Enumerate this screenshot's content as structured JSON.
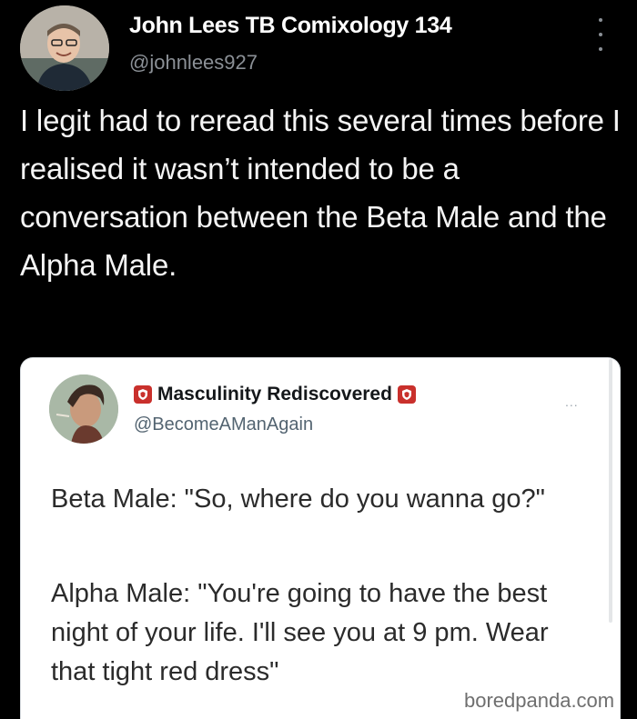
{
  "outer_tweet": {
    "display_name": "John Lees TB Comixology 134",
    "handle": "@johnlees927",
    "avatar_icon": "user-avatar-photo",
    "more_icon": "vertical-more-icon",
    "text": "I legit had to reread this several times before I realised it wasn’t intended to be a conversation between the Beta Male and the Alpha Male."
  },
  "quoted_tweet": {
    "display_name": "Masculinity Rediscovered",
    "handle": "@BecomeAManAgain",
    "more_label": "...",
    "emblem_icon": "shield-emblem-icon",
    "emblem_color": "#c9302c",
    "lines": [
      "Beta Male: \"So, where do you wanna go?\"",
      "Alpha Male: \"You're going to have the best night of your life. I'll see you at 9 pm. Wear that tight red dress\""
    ]
  },
  "watermark": "boredpanda.com",
  "colors": {
    "background": "#000000",
    "text_primary": "#f5f5f5",
    "text_secondary": "#8b9096",
    "card_background": "#ffffff"
  }
}
